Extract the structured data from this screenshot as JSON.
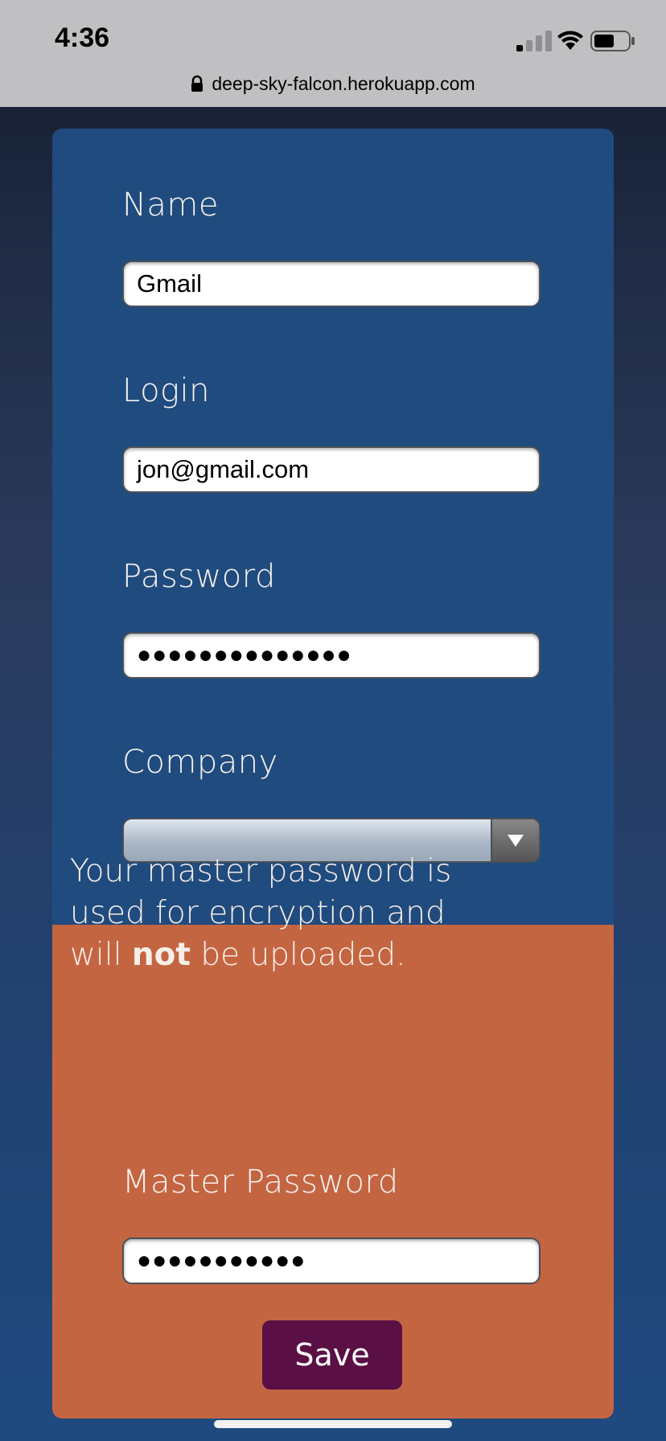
{
  "status_bar": {
    "time": "4:36",
    "url": "deep-sky-falcon.herokuapp.com",
    "icons": [
      "cellular-signal-icon",
      "wifi-icon",
      "battery-icon",
      "lock-icon"
    ]
  },
  "form": {
    "name_label": "Name",
    "name_value": "Gmail",
    "login_label": "Login",
    "login_value": "jon@gmail.com",
    "password_label": "Password",
    "password_masked": "●●●●●●●●●●●●●●",
    "company_label": "Company",
    "company_selected": ""
  },
  "master": {
    "notice_part1": "Your master password is used for encryption and will ",
    "notice_bold": "not",
    "notice_part2": " be uploaded.",
    "label": "Master Password",
    "password_masked": "●●●●●●●●●●●",
    "save_label": "Save"
  },
  "colors": {
    "blue_panel": "#204b7e",
    "orange_panel": "#c46542",
    "save_button": "#5a1044"
  }
}
